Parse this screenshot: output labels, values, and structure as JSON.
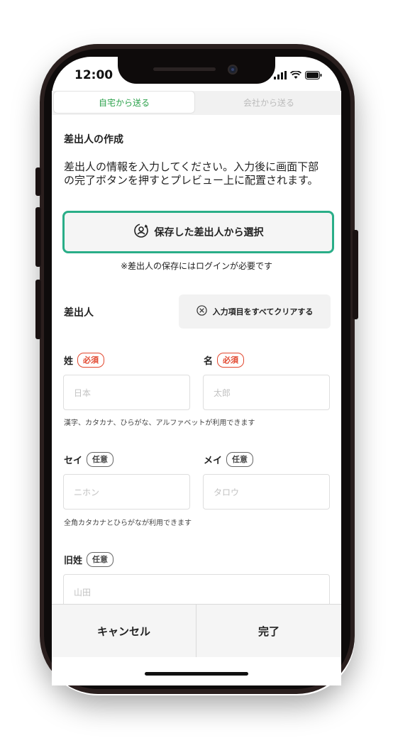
{
  "status_bar": {
    "time": "12:00"
  },
  "tabs": [
    {
      "label": "自宅から送る",
      "active": true
    },
    {
      "label": "会社から送る",
      "active": false
    }
  ],
  "section": {
    "title": "差出人の作成",
    "description": "差出人の情報を入力してください。入力後に画面下部の完了ボタンを押すとプレビュー上に配置されます。",
    "select_saved_button": "保存した差出人から選択",
    "login_note": "※差出人の保存にはログインが必要です"
  },
  "sender": {
    "label": "差出人",
    "clear_button": "入力項目をすべてクリアする"
  },
  "fields": {
    "sei": {
      "label": "姓",
      "badge": "必須",
      "placeholder": "日本"
    },
    "mei": {
      "label": "名",
      "badge": "必須",
      "placeholder": "太郎"
    },
    "name_help": "漢字、カタカナ、ひらがな、アルファベットが利用できます",
    "sei_kana": {
      "label": "セイ",
      "badge": "任意",
      "placeholder": "ニホン"
    },
    "mei_kana": {
      "label": "メイ",
      "badge": "任意",
      "placeholder": "タロウ"
    },
    "kana_help": "全角カタカナとひらがなが利用できます",
    "old_name": {
      "label": "旧姓",
      "badge": "任意",
      "placeholder": "山田"
    }
  },
  "bottom_bar": {
    "cancel": "キャンセル",
    "done": "完了"
  },
  "colors": {
    "accent_green": "#2aae88",
    "tab_active_text": "#2aa14a",
    "required_red": "#e2472e"
  },
  "icons": [
    "signal-icon",
    "wifi-icon",
    "battery-icon",
    "saved-person-icon",
    "clear-circle-x-icon"
  ]
}
